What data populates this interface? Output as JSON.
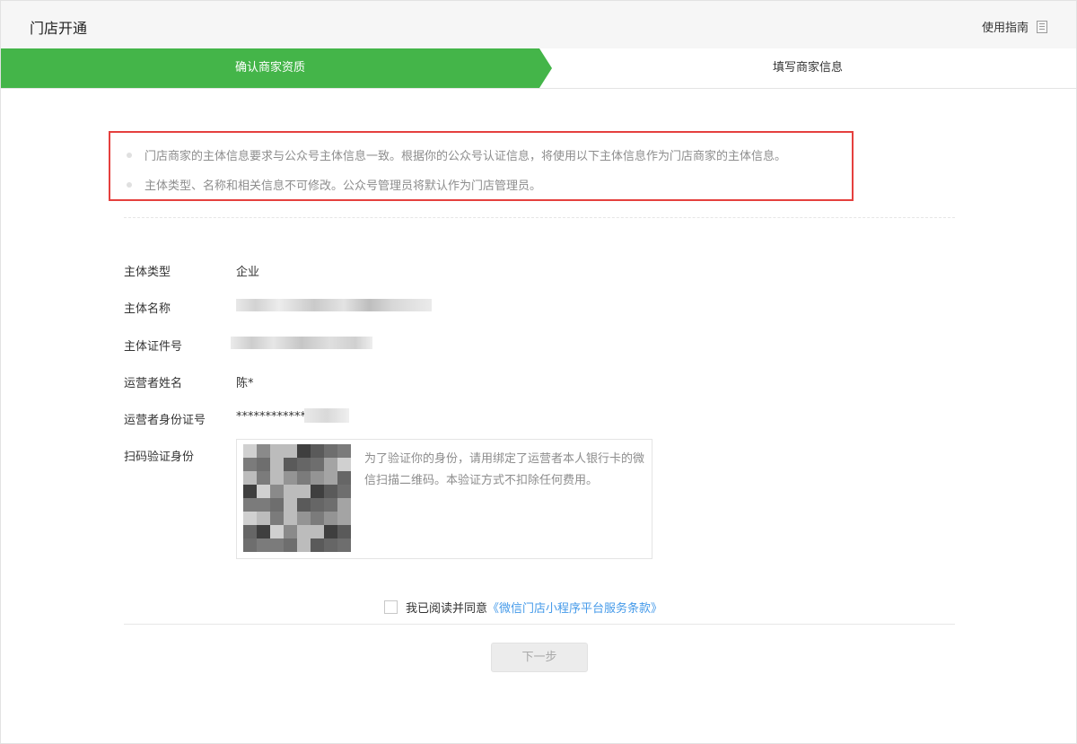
{
  "header": {
    "title": "门店开通",
    "guide_label": "使用指南",
    "guide_icon": "document-icon"
  },
  "steps": [
    {
      "label": "确认商家资质",
      "active": true
    },
    {
      "label": "填写商家信息",
      "active": false
    }
  ],
  "notice": {
    "items": [
      "门店商家的主体信息要求与公众号主体信息一致。根据你的公众号认证信息，将使用以下主体信息作为门店商家的主体信息。",
      "主体类型、名称和相关信息不可修改。公众号管理员将默认作为门店管理员。"
    ]
  },
  "fields": {
    "type_label": "主体类型",
    "type_value": "企业",
    "name_label": "主体名称",
    "cert_label": "主体证件号",
    "operator_label": "运营者姓名",
    "operator_value": "陈*",
    "id_label": "运营者身份证号",
    "id_value": "************",
    "qr_label": "扫码验证身份"
  },
  "qr_text": "为了验证你的身份，请用绑定了运营者本人银行卡的微信扫描二维码。本验证方式不扣除任何费用。",
  "agreement": {
    "prefix": "我已阅读并同意",
    "link": "《微信门店小程序平台服务条款》"
  },
  "next_button": "下一步",
  "colors": {
    "accent": "#44b549",
    "notice_border": "#e5403e",
    "link": "#459ae9"
  }
}
